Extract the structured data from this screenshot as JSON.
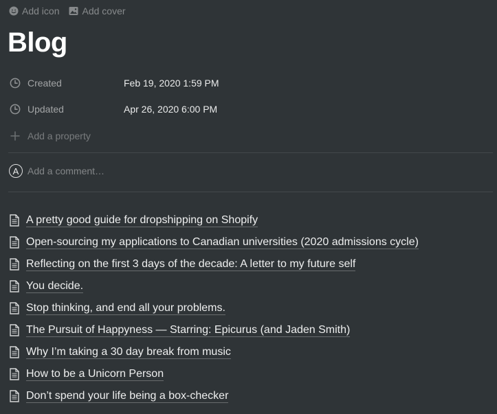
{
  "top_actions": {
    "add_icon": {
      "label": "Add icon",
      "icon": "smiley-icon"
    },
    "add_cover": {
      "label": "Add cover",
      "icon": "image-icon"
    }
  },
  "page": {
    "title": "Blog"
  },
  "properties": [
    {
      "name": "Created",
      "value": "Feb 19, 2020 1:59 PM",
      "icon": "clock-icon"
    },
    {
      "name": "Updated",
      "value": "Apr 26, 2020 6:00 PM",
      "icon": "clock-icon"
    }
  ],
  "add_property": {
    "label": "Add a property",
    "icon": "plus-icon"
  },
  "comment": {
    "avatar_letter": "A",
    "placeholder": "Add a comment…"
  },
  "pages": [
    {
      "title": "A pretty good guide for dropshipping on Shopify"
    },
    {
      "title": "Open-sourcing my applications to Canadian universities (2020 admissions cycle)"
    },
    {
      "title": "Reflecting on the first 3 days of the decade: A letter to my future self"
    },
    {
      "title": "You decide."
    },
    {
      "title": "Stop thinking, and end all your problems."
    },
    {
      "title": "The Pursuit of Happyness — Starring: Epicurus (and Jaden Smith)"
    },
    {
      "title": "Why I’m taking a 30 day break from music"
    },
    {
      "title": "How to be a Unicorn Person"
    },
    {
      "title": "Don’t spend your life being a box-checker"
    }
  ],
  "colors": {
    "background": "#2f3437",
    "text": "#ffffff"
  }
}
